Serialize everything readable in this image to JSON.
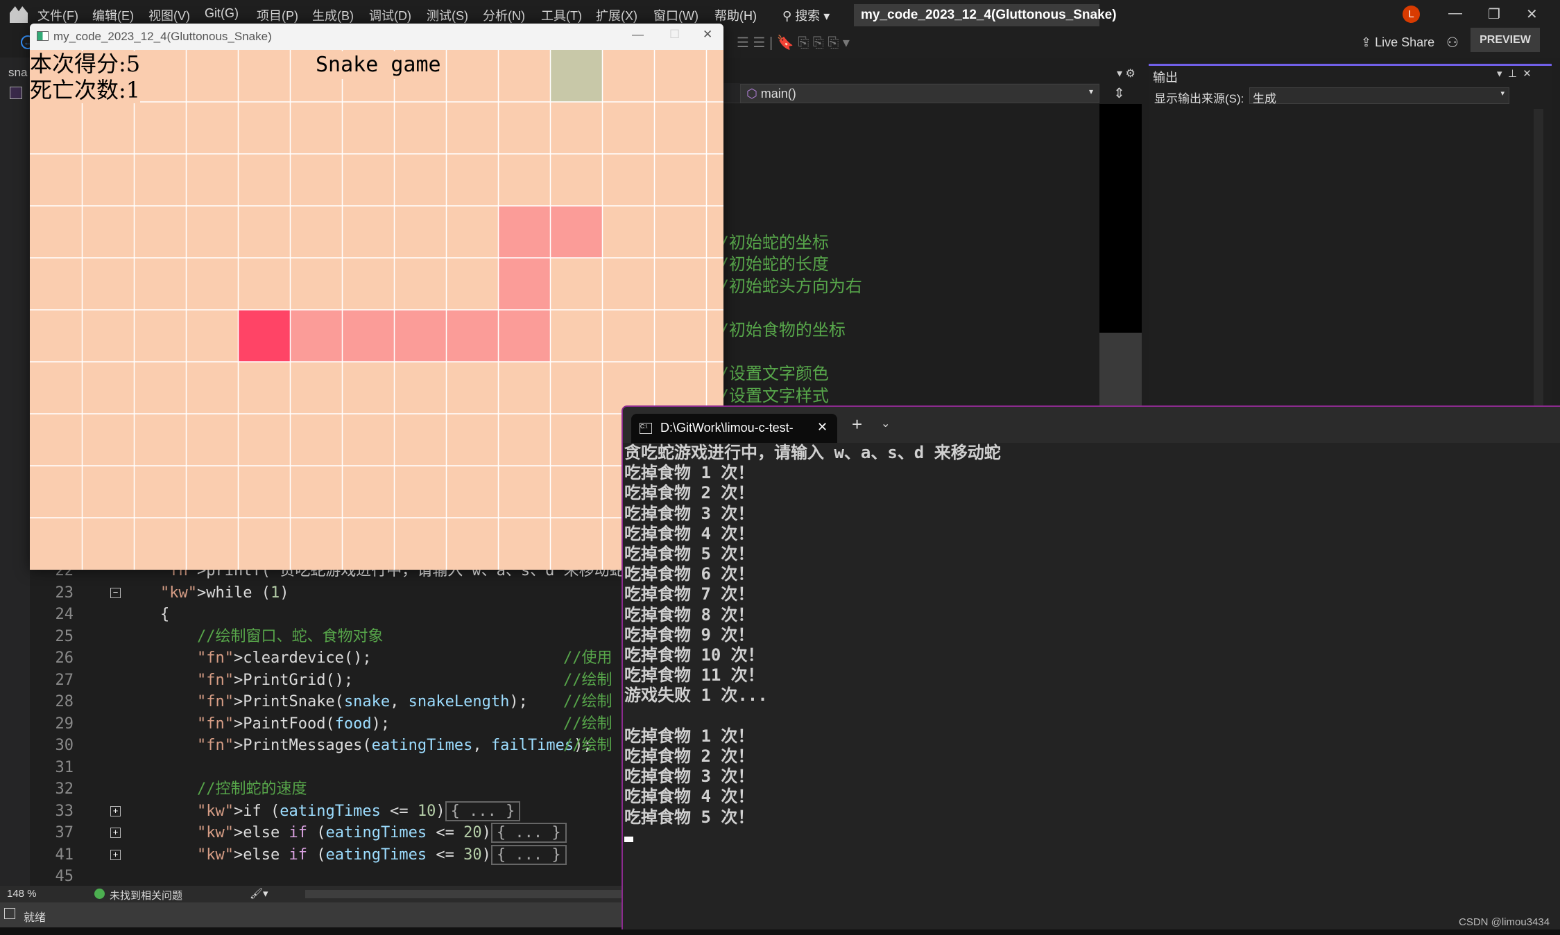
{
  "menubar": {
    "items": [
      "文件(F)",
      "编辑(E)",
      "视图(V)",
      "Git(G)",
      "项目(P)",
      "生成(B)",
      "调试(D)",
      "测试(S)",
      "分析(N)",
      "工具(T)",
      "扩展(X)",
      "窗口(W)",
      "帮助(H)"
    ],
    "search": "搜索",
    "solution_title": "my_code_2023_12_4(Gluttonous_Snake)",
    "avatar": "L"
  },
  "toolbar": {
    "live_share": "Live Share",
    "preview": "PREVIEW"
  },
  "doc_tab": "sna",
  "nav": {
    "member": "main()"
  },
  "output": {
    "title": "输出",
    "source_label": "显示输出来源(S):",
    "source_value": "生成"
  },
  "editor": {
    "lines": [
      {
        "n": "22",
        "code": "printf(\"贪吃蛇游戏进行中，请输入 w、a、s、d 来移动蛇\\n\");"
      },
      {
        "n": "23",
        "code": "while (1)"
      },
      {
        "n": "24",
        "code": "{"
      },
      {
        "n": "25",
        "code": "//绘制窗口、蛇、食物对象"
      },
      {
        "n": "26",
        "code": "cleardevice();",
        "comment": "//使用"
      },
      {
        "n": "27",
        "code": "PrintGrid();",
        "comment": "//绘制"
      },
      {
        "n": "28",
        "code": "PrintSnake(snake, snakeLength);",
        "comment": "//绘制"
      },
      {
        "n": "29",
        "code": "PaintFood(food);",
        "comment": "//绘制"
      },
      {
        "n": "30",
        "code": "PrintMessages(eatingTimes, failTimes);",
        "comment": "//绘制"
      },
      {
        "n": "31",
        "code": ""
      },
      {
        "n": "32",
        "code": "//控制蛇的速度"
      },
      {
        "n": "33",
        "code": "if (eatingTimes <= 10)"
      },
      {
        "n": "37",
        "code": "else if (eatingTimes <= 20)"
      },
      {
        "n": "41",
        "code": "else if (eatingTimes <= 30)"
      },
      {
        "n": "45",
        "code": ""
      }
    ],
    "collapsed": "{ ... }",
    "right_comments": [
      "//初始蛇的坐标",
      "//初始蛇的长度",
      "//初始蛇头方向为右",
      "//初始食物的坐标",
      "//设置文字颜色",
      "//设置文字样式"
    ],
    "zoom": "148 %",
    "issues": "未找到相关问题"
  },
  "status": "就绪",
  "game": {
    "window_title": "my_code_2023_12_4(Gluttonous_Snake)",
    "score_label": "本次得分:5",
    "death_label": "死亡次数:1",
    "heading": "Snake game",
    "grid": {
      "cols": 14,
      "rows": 10
    },
    "snake_head": [
      4,
      5
    ],
    "snake_body": [
      [
        5,
        5
      ],
      [
        6,
        5
      ],
      [
        7,
        5
      ],
      [
        8,
        5
      ],
      [
        9,
        5
      ],
      [
        9,
        4
      ],
      [
        9,
        3
      ],
      [
        10,
        3
      ]
    ],
    "food": [
      10,
      0
    ],
    "colors": {
      "background": "#facdaf",
      "grid_line": "#ffffff",
      "body": "#fb9c98",
      "head": "#ff4466",
      "food": "#c8c8a8"
    }
  },
  "terminal": {
    "tab_title": "D:\\GitWork\\limou-c-test-",
    "lines": [
      "贪吃蛇游戏进行中，请输入 w、a、s、d 来移动蛇",
      "吃掉食物 1 次！",
      "吃掉食物 2 次！",
      "吃掉食物 3 次！",
      "吃掉食物 4 次！",
      "吃掉食物 5 次！",
      "吃掉食物 6 次！",
      "吃掉食物 7 次！",
      "吃掉食物 8 次！",
      "吃掉食物 9 次！",
      "吃掉食物 10 次！",
      "吃掉食物 11 次！",
      "游戏失败 1 次...",
      "",
      "吃掉食物 1 次！",
      "吃掉食物 2 次！",
      "吃掉食物 3 次！",
      "吃掉食物 4 次！",
      "吃掉食物 5 次！"
    ]
  },
  "watermark": "CSDN @limou3434"
}
